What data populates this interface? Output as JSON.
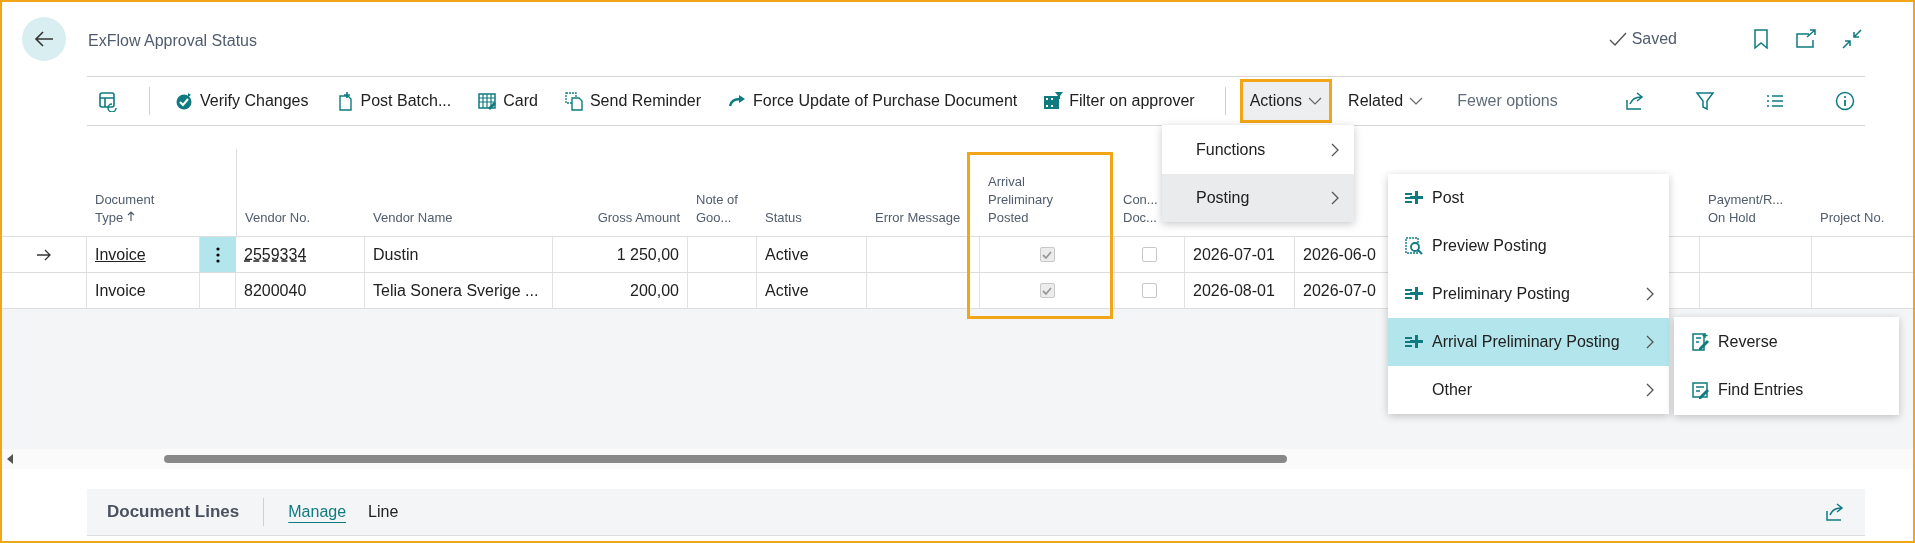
{
  "page": {
    "title": "ExFlow Approval Status",
    "save_state": "Saved"
  },
  "toolbar": {
    "actions": [
      {
        "label": "Verify Changes"
      },
      {
        "label": "Post Batch..."
      },
      {
        "label": "Card"
      },
      {
        "label": "Send Reminder"
      },
      {
        "label": "Force Update of Purchase Document"
      },
      {
        "label": "Filter on approver"
      }
    ],
    "menus": [
      {
        "label": "Actions",
        "highlighted": true,
        "open": true
      },
      {
        "label": "Related",
        "highlighted": false,
        "open": false
      }
    ],
    "fewer_options": "Fewer options"
  },
  "table": {
    "columns": [
      {
        "label": "Document Type",
        "sorted": true
      },
      {
        "label": "Vendor No.",
        "sorted": false
      },
      {
        "label": "Vendor Name",
        "sorted": false
      },
      {
        "label": "Gross Amount",
        "sorted": false
      },
      {
        "label": "Note of Goo...",
        "sorted": false
      },
      {
        "label": "Status",
        "sorted": false
      },
      {
        "label": "Error Message",
        "sorted": false
      },
      {
        "label": "Arrival Preliminary Posted",
        "sorted": false,
        "highlighted": true
      },
      {
        "label": "Con... Doc..."
      },
      {
        "label": "Payment/R... On Hold",
        "sorted": false
      },
      {
        "label": "Project No.",
        "sorted": false
      }
    ],
    "rows": [
      {
        "selected": true,
        "document_type": "Invoice",
        "vendor_no": "2559334",
        "vendor_name": "Dustin",
        "gross_amount": "1 250,00",
        "status": "Active",
        "arrival_posted": true,
        "con_doc": false,
        "due_date": "2026-07-01",
        "posting_date": "2026-06-0"
      },
      {
        "selected": false,
        "document_type": "Invoice",
        "vendor_no": "8200040",
        "vendor_name": "Telia Sonera Sverige ...",
        "gross_amount": "200,00",
        "status": "Active",
        "arrival_posted": true,
        "con_doc": false,
        "due_date": "2026-08-01",
        "posting_date": "2026-07-0"
      }
    ]
  },
  "actions_menu": {
    "items": [
      {
        "label": "Functions",
        "selected": false
      },
      {
        "label": "Posting",
        "selected": true
      }
    ]
  },
  "posting_menu": {
    "items": [
      {
        "label": "Post",
        "selected": false,
        "submenu": false
      },
      {
        "label": "Preview Posting",
        "selected": false,
        "submenu": false
      },
      {
        "label": "Preliminary Posting",
        "selected": false,
        "submenu": true
      },
      {
        "label": "Arrival Preliminary Posting",
        "selected": true,
        "submenu": true
      },
      {
        "label": "Other",
        "selected": false,
        "submenu": true
      }
    ]
  },
  "arrival_menu": {
    "items": [
      {
        "label": "Reverse"
      },
      {
        "label": "Find Entries"
      }
    ]
  },
  "document_lines": {
    "title": "Document Lines",
    "tabs": [
      {
        "label": "Manage",
        "selected": true
      },
      {
        "label": "Line",
        "selected": false
      }
    ]
  }
}
